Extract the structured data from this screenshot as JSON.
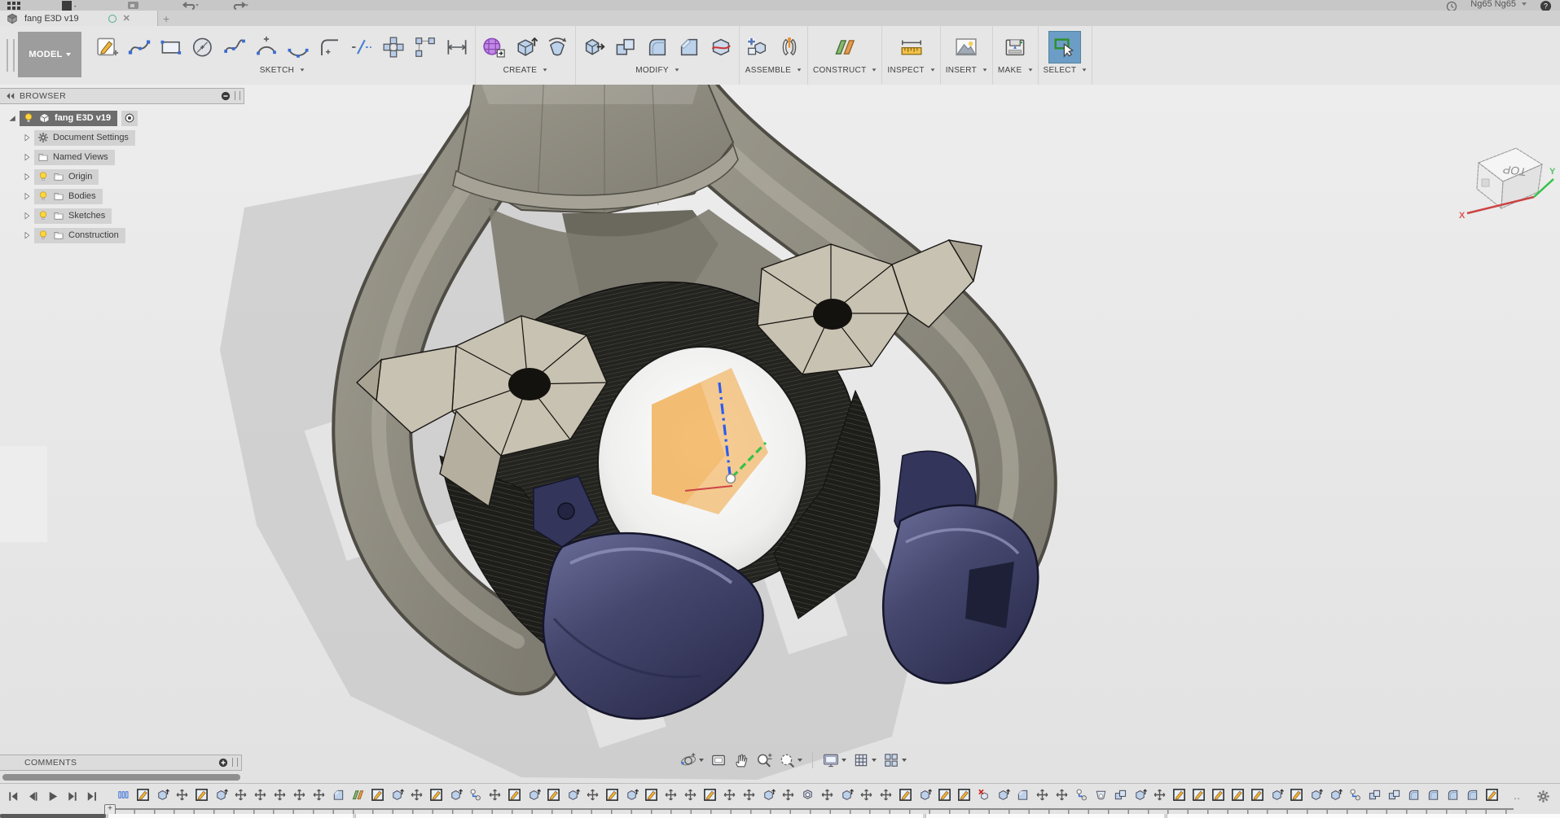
{
  "colors": {
    "accent_select": "#6c9dc6",
    "body_taupe": "#8e8b7f",
    "body_dark": "#4e4c44",
    "body_light": "#b6b2a6",
    "gem_tan": "#c8c2b2",
    "navy": "#45476e",
    "navy_dark": "#1c1d38",
    "navy_light": "#8e91b8",
    "plane_orange": "#f0a43c",
    "axis_red": "#cc4444",
    "axis_green": "#35c24a",
    "axis_blue": "#2b5cf0",
    "viewport_bg": "#e9e9e9",
    "shadow_gray": "#c2c2c2"
  },
  "app_bar": {
    "user_name": "Ng65 Ng65",
    "help_label": "?"
  },
  "tab_bar": {
    "active_tab_title": "fang E3D v19",
    "new_tab_label": "+"
  },
  "toolbar": {
    "model_menu_label": "MODEL",
    "groups": [
      {
        "label": "SKETCH",
        "icons": [
          "create-sketch",
          "spline",
          "rectangle",
          "circle",
          "fit-point-spline",
          "arc",
          "three-point-arc",
          "sketch-fillet",
          "trim",
          "circular-pattern",
          "rectangular-pattern",
          "sketch-dimension"
        ]
      },
      {
        "label": "CREATE",
        "icons": [
          "form",
          "extrude",
          "revolve"
        ]
      },
      {
        "label": "MODIFY",
        "icons": [
          "press-pull",
          "combine",
          "fillet",
          "chamfer",
          "split-body"
        ]
      },
      {
        "label": "ASSEMBLE",
        "icons": [
          "new-component",
          "joint"
        ]
      },
      {
        "label": "CONSTRUCT",
        "icons": [
          "construct-plane"
        ]
      },
      {
        "label": "INSPECT",
        "icons": [
          "measure"
        ]
      },
      {
        "label": "INSERT",
        "icons": [
          "insert-image"
        ]
      },
      {
        "label": "MAKE",
        "icons": [
          "make-3d-print"
        ]
      },
      {
        "label": "SELECT",
        "icons": [
          "select"
        ],
        "active": true
      }
    ]
  },
  "browser": {
    "panel_title": "BROWSER",
    "root_label": "fang E3D v19",
    "items": [
      {
        "label": "Document Settings",
        "icon": "gear",
        "bulb": false
      },
      {
        "label": "Named Views",
        "icon": "folder",
        "bulb": false
      },
      {
        "label": "Origin",
        "icon": "folder",
        "bulb": true
      },
      {
        "label": "Bodies",
        "icon": "folder",
        "bulb": true
      },
      {
        "label": "Sketches",
        "icon": "folder",
        "bulb": true
      },
      {
        "label": "Construction",
        "icon": "folder",
        "bulb": true
      }
    ]
  },
  "viewcube": {
    "top_face_label": "TOP",
    "axis_x_label": "X",
    "axis_y_label": "Y"
  },
  "comments": {
    "panel_title": "COMMENTS"
  },
  "nav_bar": {
    "buttons": [
      {
        "name": "orbit",
        "dropdown": true
      },
      {
        "name": "look-at",
        "dropdown": false
      },
      {
        "name": "pan",
        "dropdown": false
      },
      {
        "name": "zoom",
        "dropdown": false
      },
      {
        "name": "window-zoom",
        "dropdown": true
      },
      {
        "sep": true
      },
      {
        "name": "display-settings",
        "dropdown": true
      },
      {
        "name": "grid-layout",
        "dropdown": true
      },
      {
        "name": "viewports",
        "dropdown": true
      }
    ]
  },
  "timeline": {
    "playback": [
      "go-to-start",
      "step-back",
      "play",
      "step-forward",
      "go-to-end"
    ],
    "overflow_label": "‥",
    "features": [
      "group",
      "sketch",
      "extrude",
      "move",
      "sketch",
      "extrude",
      "move",
      "move",
      "move",
      "move",
      "move",
      "chamfer",
      "plane",
      "sketch",
      "extrude",
      "move",
      "sketch",
      "extrude",
      "joint",
      "move",
      "sketch",
      "extrude",
      "sketch",
      "extrude",
      "move",
      "sketch",
      "extrude",
      "sketch",
      "move",
      "move",
      "sketch",
      "move",
      "move",
      "extrude",
      "move",
      "revolve",
      "move",
      "extrude",
      "move",
      "move",
      "sketch",
      "extrude",
      "sketch",
      "sketch",
      "delete",
      "extrude",
      "chamfer",
      "move",
      "move",
      "joint",
      "shell",
      "combine",
      "extrude",
      "move",
      "sketch",
      "sketch",
      "sketch",
      "sketch",
      "sketch",
      "extrude",
      "sketch",
      "extrude",
      "extrude",
      "joint",
      "combine",
      "combine",
      "fillet",
      "fillet",
      "fillet",
      "fillet",
      "sketch"
    ]
  }
}
